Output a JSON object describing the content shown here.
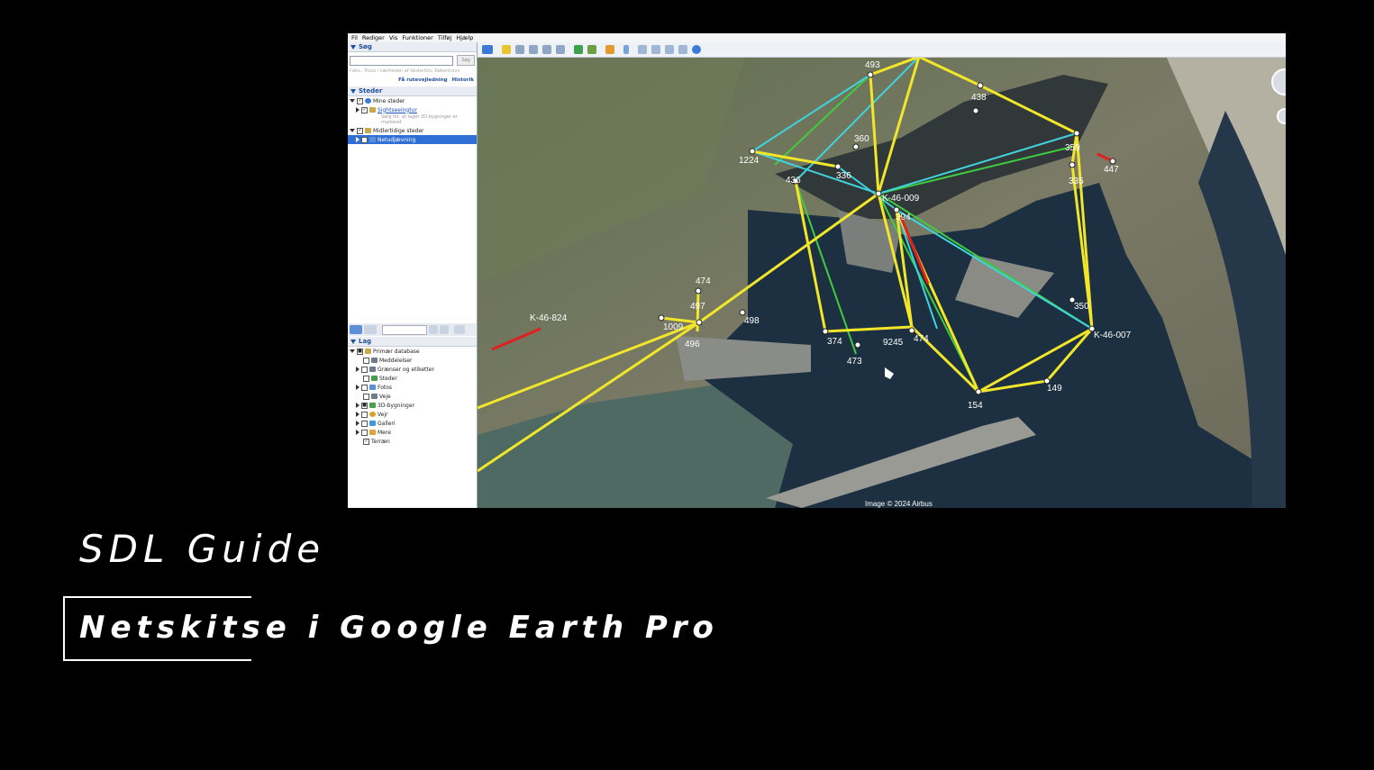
{
  "menu": [
    "Fil",
    "Rediger",
    "Vis",
    "Funktioner",
    "Tilføj",
    "Hjælp"
  ],
  "search": {
    "header": "Søg",
    "button": "Søg",
    "hint": "f.eks., Pizza i nærheden af Vesterbro, København",
    "route_link": "Få rutevejledning",
    "history_link": "Historik"
  },
  "places": {
    "header": "Steder",
    "my_places": "Mine steder",
    "sightseeing": "Sightseeingtur",
    "sightseeing_desc": "Sørg for, at laget 3D-bygninger er markeret",
    "temp_places": "Midlertidige steder",
    "net_layer": "Netudjævning"
  },
  "layers": {
    "header": "Lag",
    "items": [
      "Primær database",
      "Meddelelser",
      "Grænser og etiketter",
      "Steder",
      "Fotos",
      "Veje",
      "3D-bygninger",
      "Vejr",
      "Galleri",
      "Mere",
      "Terræn"
    ]
  },
  "map": {
    "credit": "Image © 2024 Airbus",
    "points": [
      "493",
      "K-46-824",
      "1009",
      "496",
      "497",
      "474",
      "498",
      "374",
      "473",
      "9245",
      "474",
      "K-46-009",
      "394",
      "360",
      "336",
      "436",
      "1224",
      "154",
      "149",
      "K-46-007",
      "350",
      "335",
      "359",
      "447",
      "438"
    ]
  },
  "slide": {
    "title": "SDL Guide",
    "subtitle": "Netskitse i Google Earth Pro"
  },
  "colors": {
    "yellow_line": "#f2e62a",
    "cyan_line": "#3fd3dd",
    "green_line": "#3fcc3f",
    "red_line": "#e02020"
  }
}
